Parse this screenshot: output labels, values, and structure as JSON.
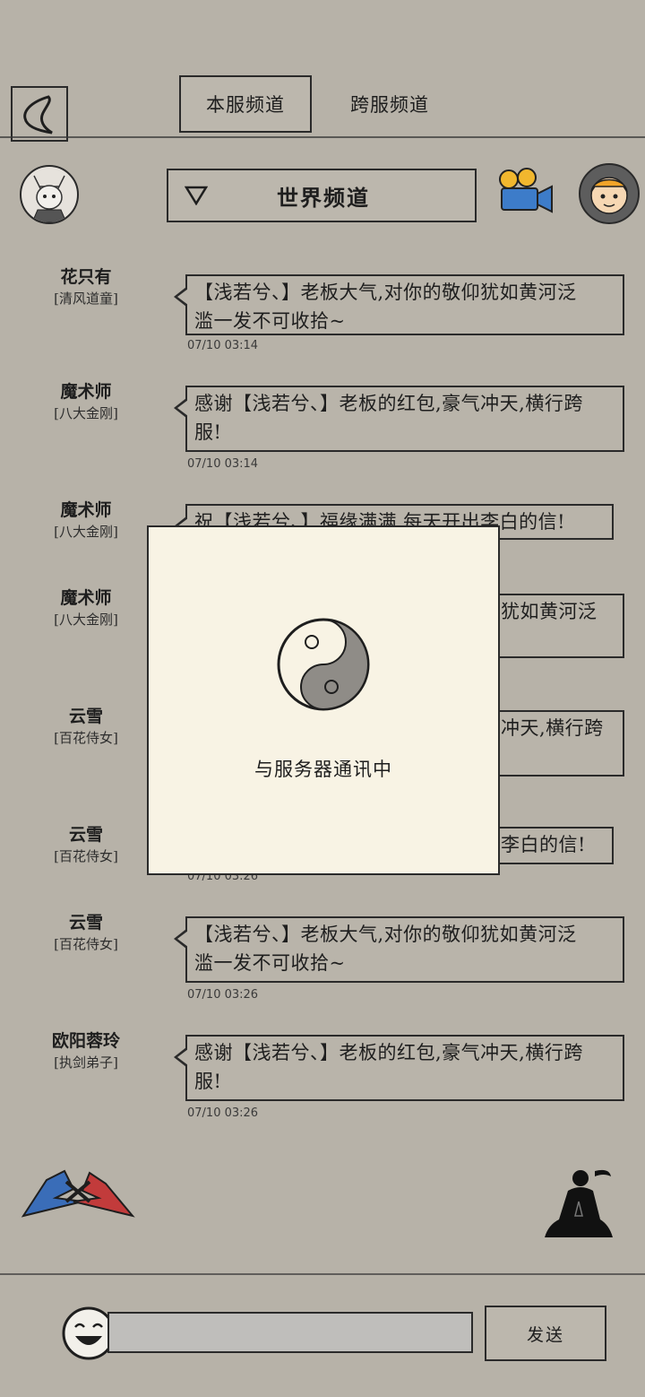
{
  "header": {
    "tabs": [
      {
        "label": "本服频道",
        "active": true
      },
      {
        "label": "跨服频道",
        "active": false
      }
    ]
  },
  "channel": {
    "name": "世界频道"
  },
  "messages": [
    {
      "sender": "花只有",
      "sect": "[清风道童]",
      "lines": [
        "【浅若兮、】老板大气,对你的敬仰犹如黄河泛",
        "滥一发不可收拾~"
      ],
      "time": "07/10 03:14"
    },
    {
      "sender": "魔术师",
      "sect": "[八大金刚]",
      "lines": [
        "感谢【浅若兮、】老板的红包,豪气冲天,横行跨",
        "服!"
      ],
      "time": "07/10 03:14"
    },
    {
      "sender": "魔术师",
      "sect": "[八大金刚]",
      "lines": [
        "祝【浅若兮、】福缘满满,每天开出李白的信!"
      ],
      "time": ""
    },
    {
      "sender": "魔术师",
      "sect": "[八大金刚]",
      "lines": [
        "犹如黄河泛",
        ""
      ],
      "time": ""
    },
    {
      "sender": "云雪",
      "sect": "[百花侍女]",
      "lines": [
        "冲天,横行跨",
        ""
      ],
      "time": ""
    },
    {
      "sender": "云雪",
      "sect": "[百花侍女]",
      "lines": [
        "李白的信!"
      ],
      "time": "07/10 03:26"
    },
    {
      "sender": "云雪",
      "sect": "[百花侍女]",
      "lines": [
        "【浅若兮、】老板大气,对你的敬仰犹如黄河泛",
        "滥一发不可收拾~"
      ],
      "time": "07/10 03:26"
    },
    {
      "sender": "欧阳蓉玲",
      "sect": "[执剑弟子]",
      "lines": [
        "感谢【浅若兮、】老板的红包,豪气冲天,横行跨",
        "服!"
      ],
      "time": "07/10 03:26"
    }
  ],
  "modal": {
    "text": "与服务器通讯中"
  },
  "footer": {
    "input_value": "",
    "send_label": "发送"
  },
  "icons": {
    "back": "back-arrow-icon",
    "camera": "film-camera-icon",
    "support": "customer-service-icon",
    "pvp": "crossed-swords-icon",
    "meditate": "meditating-figure-icon",
    "emoji": "smiley-face-icon",
    "loading": "yin-yang-icon"
  },
  "colors": {
    "background": "#b7b2a8",
    "modal": "#f8f3e4",
    "ink": "#1e1e1e"
  }
}
